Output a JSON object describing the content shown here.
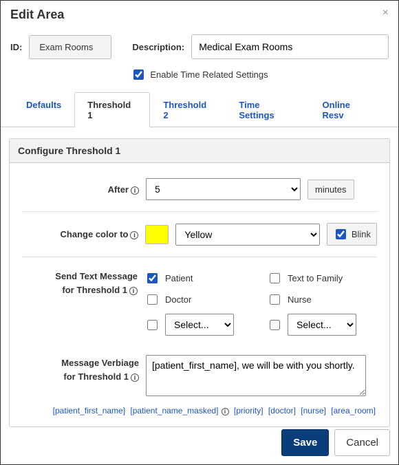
{
  "dialog": {
    "title": "Edit Area"
  },
  "form": {
    "id_label": "ID:",
    "id_value": "Exam Rooms",
    "desc_label": "Description:",
    "desc_value": "Medical Exam Rooms",
    "enable_label": "Enable Time Related Settings",
    "enable_checked": true
  },
  "tabs": {
    "defaults": "Defaults",
    "threshold1": "Threshold 1",
    "threshold2": "Threshold 2",
    "time_settings": "Time Settings",
    "online_resv": "Online Resv"
  },
  "panel": {
    "title": "Configure Threshold 1",
    "after_label": "After",
    "after_value": "5",
    "after_unit": "minutes",
    "color_label": "Change color to",
    "color_value": "Yellow",
    "color_swatch": "#ffff00",
    "blink_label": "Blink",
    "blink_checked": true,
    "send_label_line1": "Send Text Message",
    "send_label_line2": "for Threshold 1",
    "recipients": {
      "patient": {
        "label": "Patient",
        "checked": true
      },
      "text_family": {
        "label": "Text to Family",
        "checked": false
      },
      "doctor": {
        "label": "Doctor",
        "checked": false
      },
      "nurse": {
        "label": "Nurse",
        "checked": false
      },
      "select_a": "Select...",
      "select_b": "Select..."
    },
    "verbiage_label_line1": "Message Verbiage",
    "verbiage_label_line2": "for Threshold 1",
    "verbiage_value": "[patient_first_name], we will be with you shortly."
  },
  "tokens": {
    "t1": "[patient_first_name]",
    "t2": "[patient_name_masked]",
    "t3": "[priority]",
    "t4": "[doctor]",
    "t5": "[nurse]",
    "t6": "[area_room]"
  },
  "footer": {
    "save": "Save",
    "cancel": "Cancel"
  }
}
